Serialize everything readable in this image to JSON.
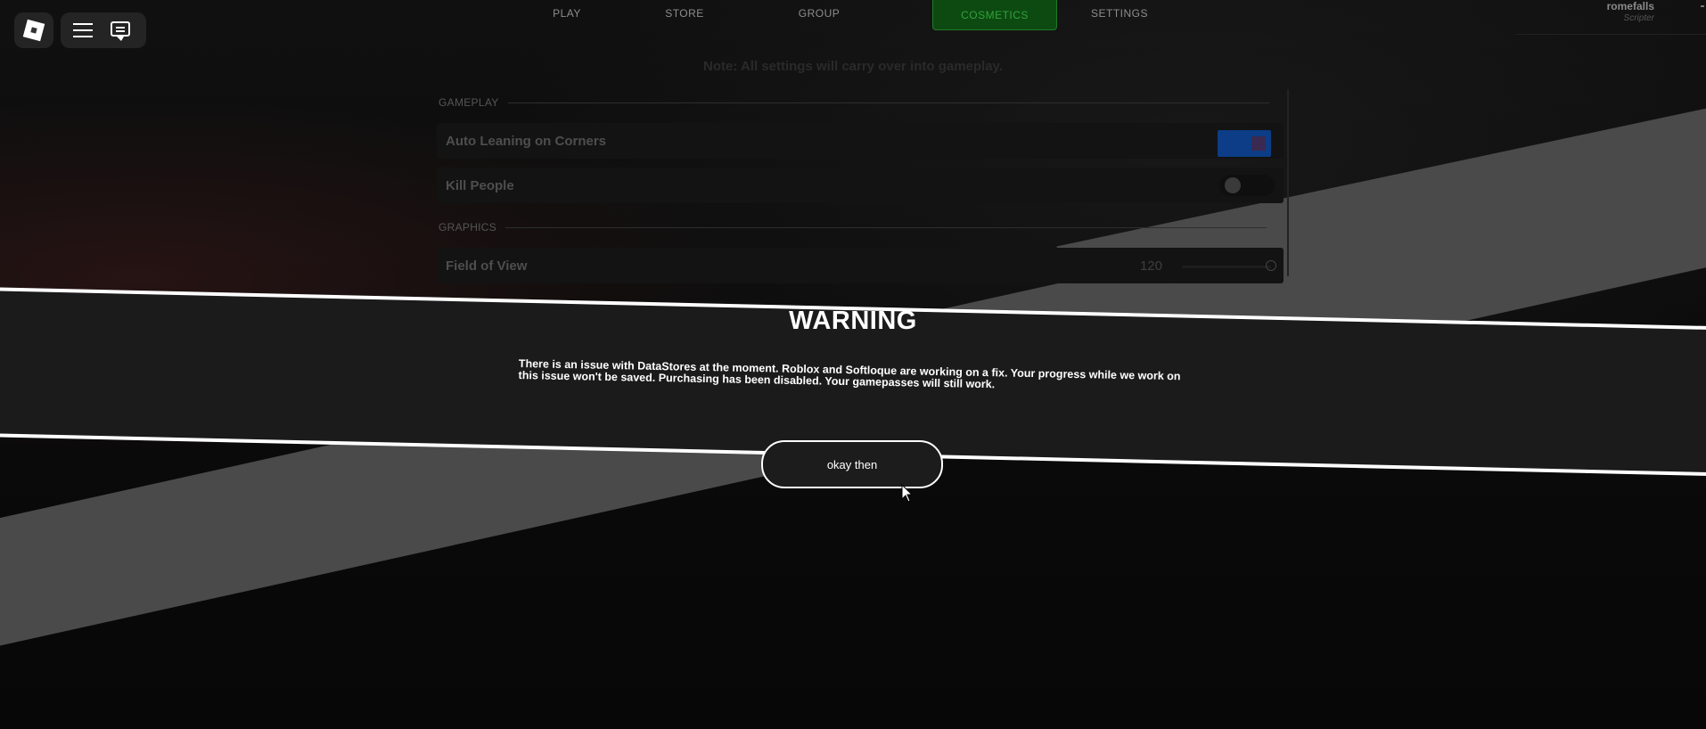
{
  "topbar": {
    "roblox_logo_icon": "roblox-logo",
    "menu_icon": "hamburger-menu",
    "chat_icon": "chat-bubble"
  },
  "nav": {
    "tabs": [
      {
        "label": "PLAY"
      },
      {
        "label": "STORE"
      },
      {
        "label": "GROUP"
      },
      {
        "label": "COSMETICS",
        "active": true
      },
      {
        "label": "SETTINGS"
      }
    ]
  },
  "user": {
    "name": "romefalls",
    "role": "Scripter"
  },
  "note": "Note: All settings will carry over into gameplay.",
  "settings": {
    "sections": [
      {
        "title": "GAMEPLAY"
      },
      {
        "title": "GRAPHICS"
      }
    ],
    "rows": [
      {
        "label": "Auto Leaning on Corners",
        "state": "on"
      },
      {
        "label": "Kill People",
        "state": "off"
      },
      {
        "label": "Field of View",
        "value": "120"
      }
    ]
  },
  "warning": {
    "title": "WARNING",
    "message": "There is an issue with DataStores at the moment. Roblox and Softloque are working on a fix. Your progress while we work on this issue won't be saved. Purchasing has been disabled. Your gamepasses will still work.",
    "button_label": "okay then"
  },
  "colors": {
    "cosmetics_tab_bg": "#0d4a12",
    "cosmetics_tab_text": "#2fa33a",
    "toggle_on": "#0c3d86",
    "banner_bg": "#1b1b1b",
    "banner_border": "#ffffff"
  }
}
